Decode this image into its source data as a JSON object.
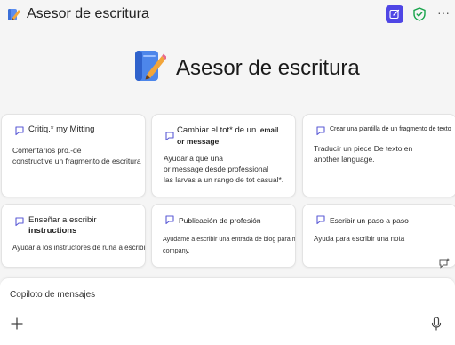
{
  "app": {
    "title": "Asesor de escritura",
    "icon": "pen-notebook-icon"
  },
  "toolbar": {
    "new_chat_icon": "edit-square-icon",
    "shield_icon": "shield-check-icon",
    "more_label": "···"
  },
  "hero": {
    "title": "Asesor de escritura"
  },
  "cards": [
    {
      "title": "Critiq.* my Mitting",
      "desc": [
        "Comentarios pro.-de",
        "constructive un fragmento de escritura"
      ]
    },
    {
      "title_line1": "Cambiar el tot* de un",
      "title_email": "email",
      "title_line2": "or message",
      "desc": [
        "Ayudar a que una",
        "or message",
        "desde",
        "professional",
        "las larvas a un rango de tot casual*."
      ]
    },
    {
      "title": "Crear una plantilla de un fragmento de texto",
      "desc_a": "Traducir un",
      "desc_b": "piece",
      "desc_c": "De texto en",
      "desc_d": "another language."
    },
    {
      "title": "Enseñar a escribir",
      "title_line2": "instructions",
      "desc": [
        "Ayudar a los instructores de runa a escribir"
      ]
    },
    {
      "title": "Publicación de profesión",
      "desc": [
        "Ayudame a escribir una entrada de blog para mi",
        "company."
      ]
    },
    {
      "title": "Escribir un paso a paso",
      "desc": [
        "Ayuda para escribir una nota"
      ]
    }
  ],
  "composer": {
    "placeholder": "Copiloto de mensajes"
  },
  "colors": {
    "accent": "#4f46e5",
    "shield": "#16a34a",
    "background": "#f5f5f5"
  }
}
